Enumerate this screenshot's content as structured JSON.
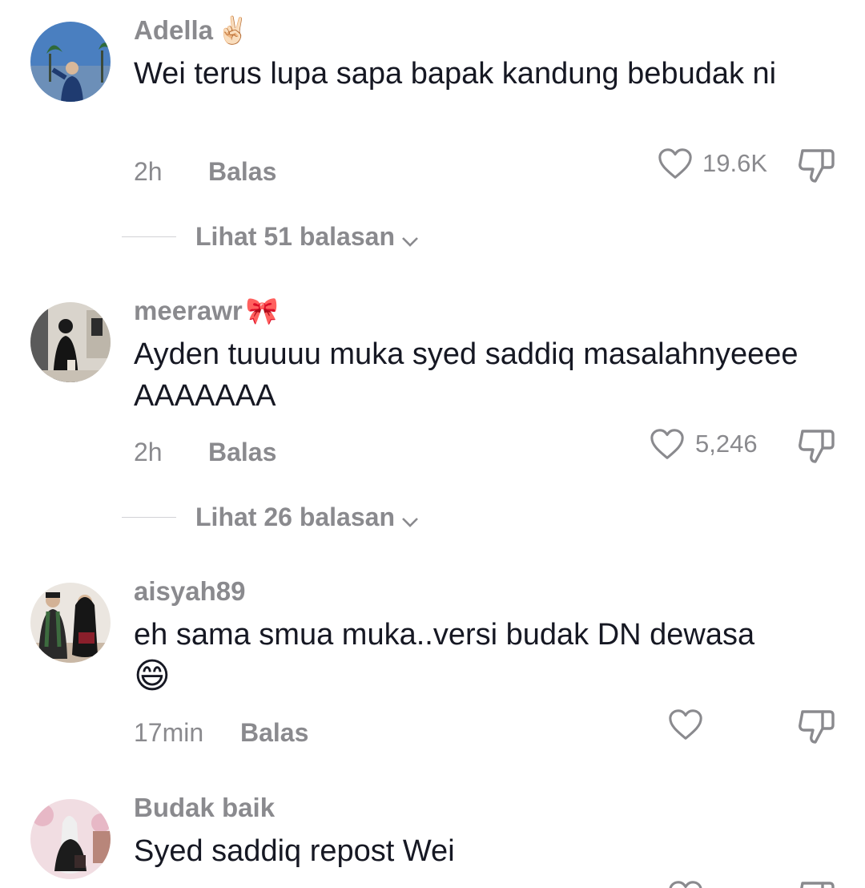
{
  "comments": [
    {
      "username": "Adella",
      "username_emoji": "✌🏻",
      "text": "Wei terus lupa sapa bapak kandung bebudak ni",
      "time": "2h",
      "reply_label": "Balas",
      "likes": "19.6K",
      "view_replies": "Lihat 51 balasan"
    },
    {
      "username": "meerawr",
      "username_emoji": "🎀",
      "text": "Ayden tuuuuu muka syed saddiq masalahnyeeee AAAAAAA",
      "time": "2h",
      "reply_label": "Balas",
      "likes": "5,246",
      "view_replies": "Lihat 26 balasan"
    },
    {
      "username": "aisyah89",
      "text": "eh sama smua muka..versi budak DN dewasa",
      "text_emoji": "😄",
      "time": "17min",
      "reply_label": "Balas",
      "likes": ""
    },
    {
      "username": "Budak baik",
      "text": "Syed saddiq repost Wei"
    }
  ],
  "colors": {
    "username": "#8a8a8e",
    "text": "#161823",
    "meta": "#8a8a8e",
    "divider": "#d2d2d6"
  },
  "icons": {
    "like": "heart-outline-icon",
    "dislike": "thumbs-down-outline-icon",
    "expand": "chevron-down-icon"
  }
}
